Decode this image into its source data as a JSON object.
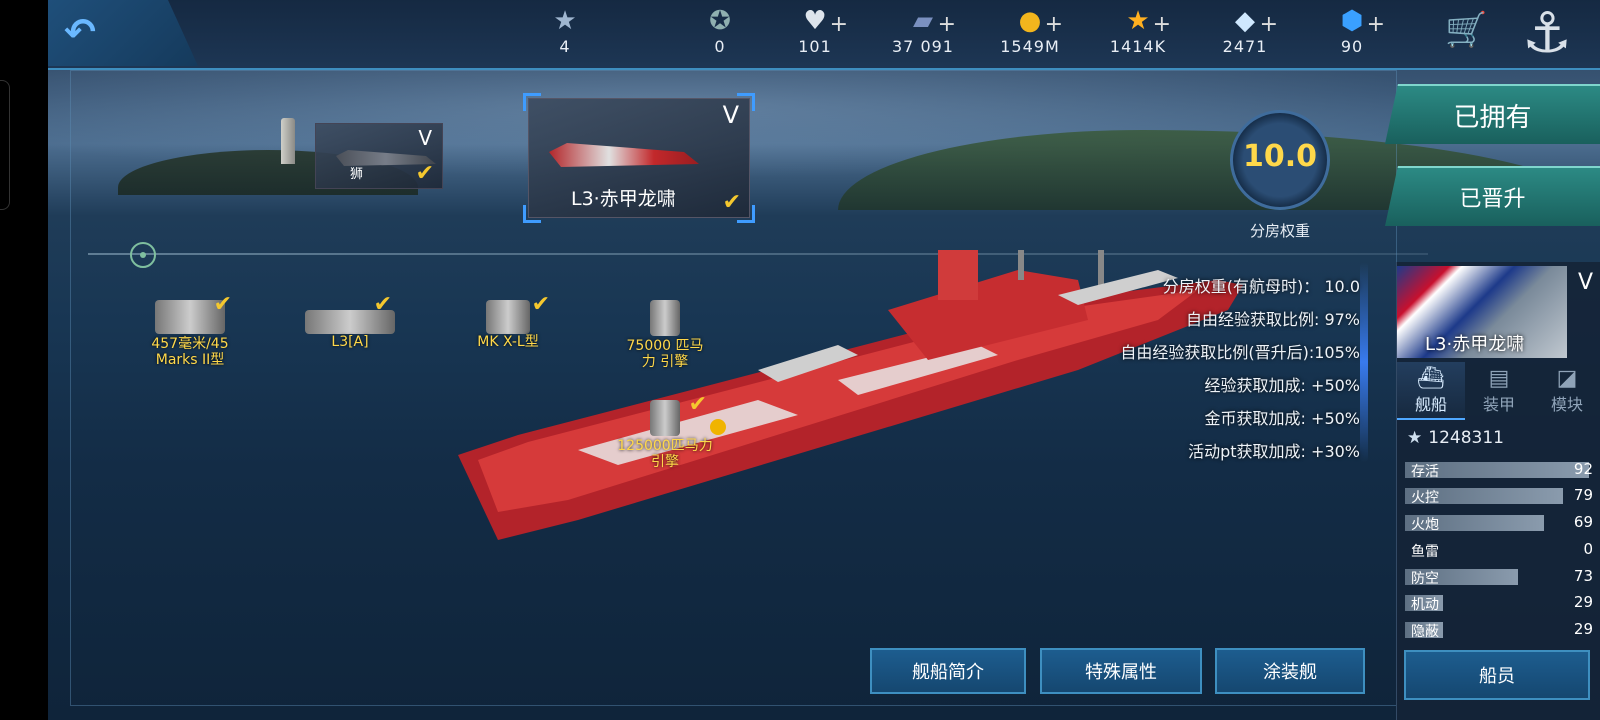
{
  "topbar": {
    "resources": [
      {
        "icon": "rank-star-badge-icon",
        "value": "4",
        "plus": false
      },
      {
        "icon": "token-coin-icon",
        "value": "0",
        "plus": false
      },
      {
        "icon": "heart-icon",
        "value": "101",
        "plus": true
      },
      {
        "icon": "card-icon",
        "value": "37 091",
        "plus": true
      },
      {
        "icon": "gold-coin-icon",
        "value": "1549M",
        "plus": true
      },
      {
        "icon": "star-icon",
        "value": "1414K",
        "plus": true
      },
      {
        "icon": "diamond-icon",
        "value": "2471",
        "plus": true
      },
      {
        "icon": "blue-gem-icon",
        "value": "90",
        "plus": true
      }
    ],
    "plus_symbol": "+"
  },
  "ship_cards": [
    {
      "name": "狮",
      "tier": "V"
    },
    {
      "name": "L3·赤甲龙啸",
      "tier": "V"
    }
  ],
  "equipment": [
    {
      "label": "457毫米/45 Marks II型"
    },
    {
      "label": "L3[A]"
    },
    {
      "label": "MK X-L型"
    },
    {
      "label": "75000 匹马力 引擎"
    },
    {
      "label": "125000匹马力 引擎"
    }
  ],
  "rating": {
    "value": "10.0",
    "label": "分房权重"
  },
  "ship_stats": [
    {
      "label": "分房权重(有航母时)：",
      "value": "10.0"
    },
    {
      "label": "自由经验获取比例:",
      "value": "97%"
    },
    {
      "label": "自由经验获取比例(晋升后):",
      "value": "105%"
    },
    {
      "label": "经验获取加成:",
      "value": "+50%"
    },
    {
      "label": "金币获取加成:",
      "value": "+50%"
    },
    {
      "label": "活动pt获取加成:",
      "value": "+30%"
    }
  ],
  "right_buttons": {
    "owned": "已拥有",
    "promoted": "已晋升"
  },
  "panel": {
    "tier": "V",
    "ship_name": "L3·赤甲龙啸",
    "tabs": [
      "舰船",
      "装甲",
      "模块"
    ],
    "power": "1248311",
    "stats": [
      {
        "label": "存活",
        "value": 92
      },
      {
        "label": "火控",
        "value": 79
      },
      {
        "label": "火炮",
        "value": 69
      },
      {
        "label": "鱼雷",
        "value": 0
      },
      {
        "label": "防空",
        "value": 73
      },
      {
        "label": "机动",
        "value": 29
      },
      {
        "label": "隐蔽",
        "value": 29
      }
    ],
    "crew_button": "船员"
  },
  "bottom_buttons": [
    "舰船简介",
    "特殊属性",
    "涂装舰"
  ],
  "colors": {
    "accent": "#3e8fc0",
    "gold": "#ffd84a",
    "check": "#f5c82e",
    "green_button": "#2c8a84"
  }
}
